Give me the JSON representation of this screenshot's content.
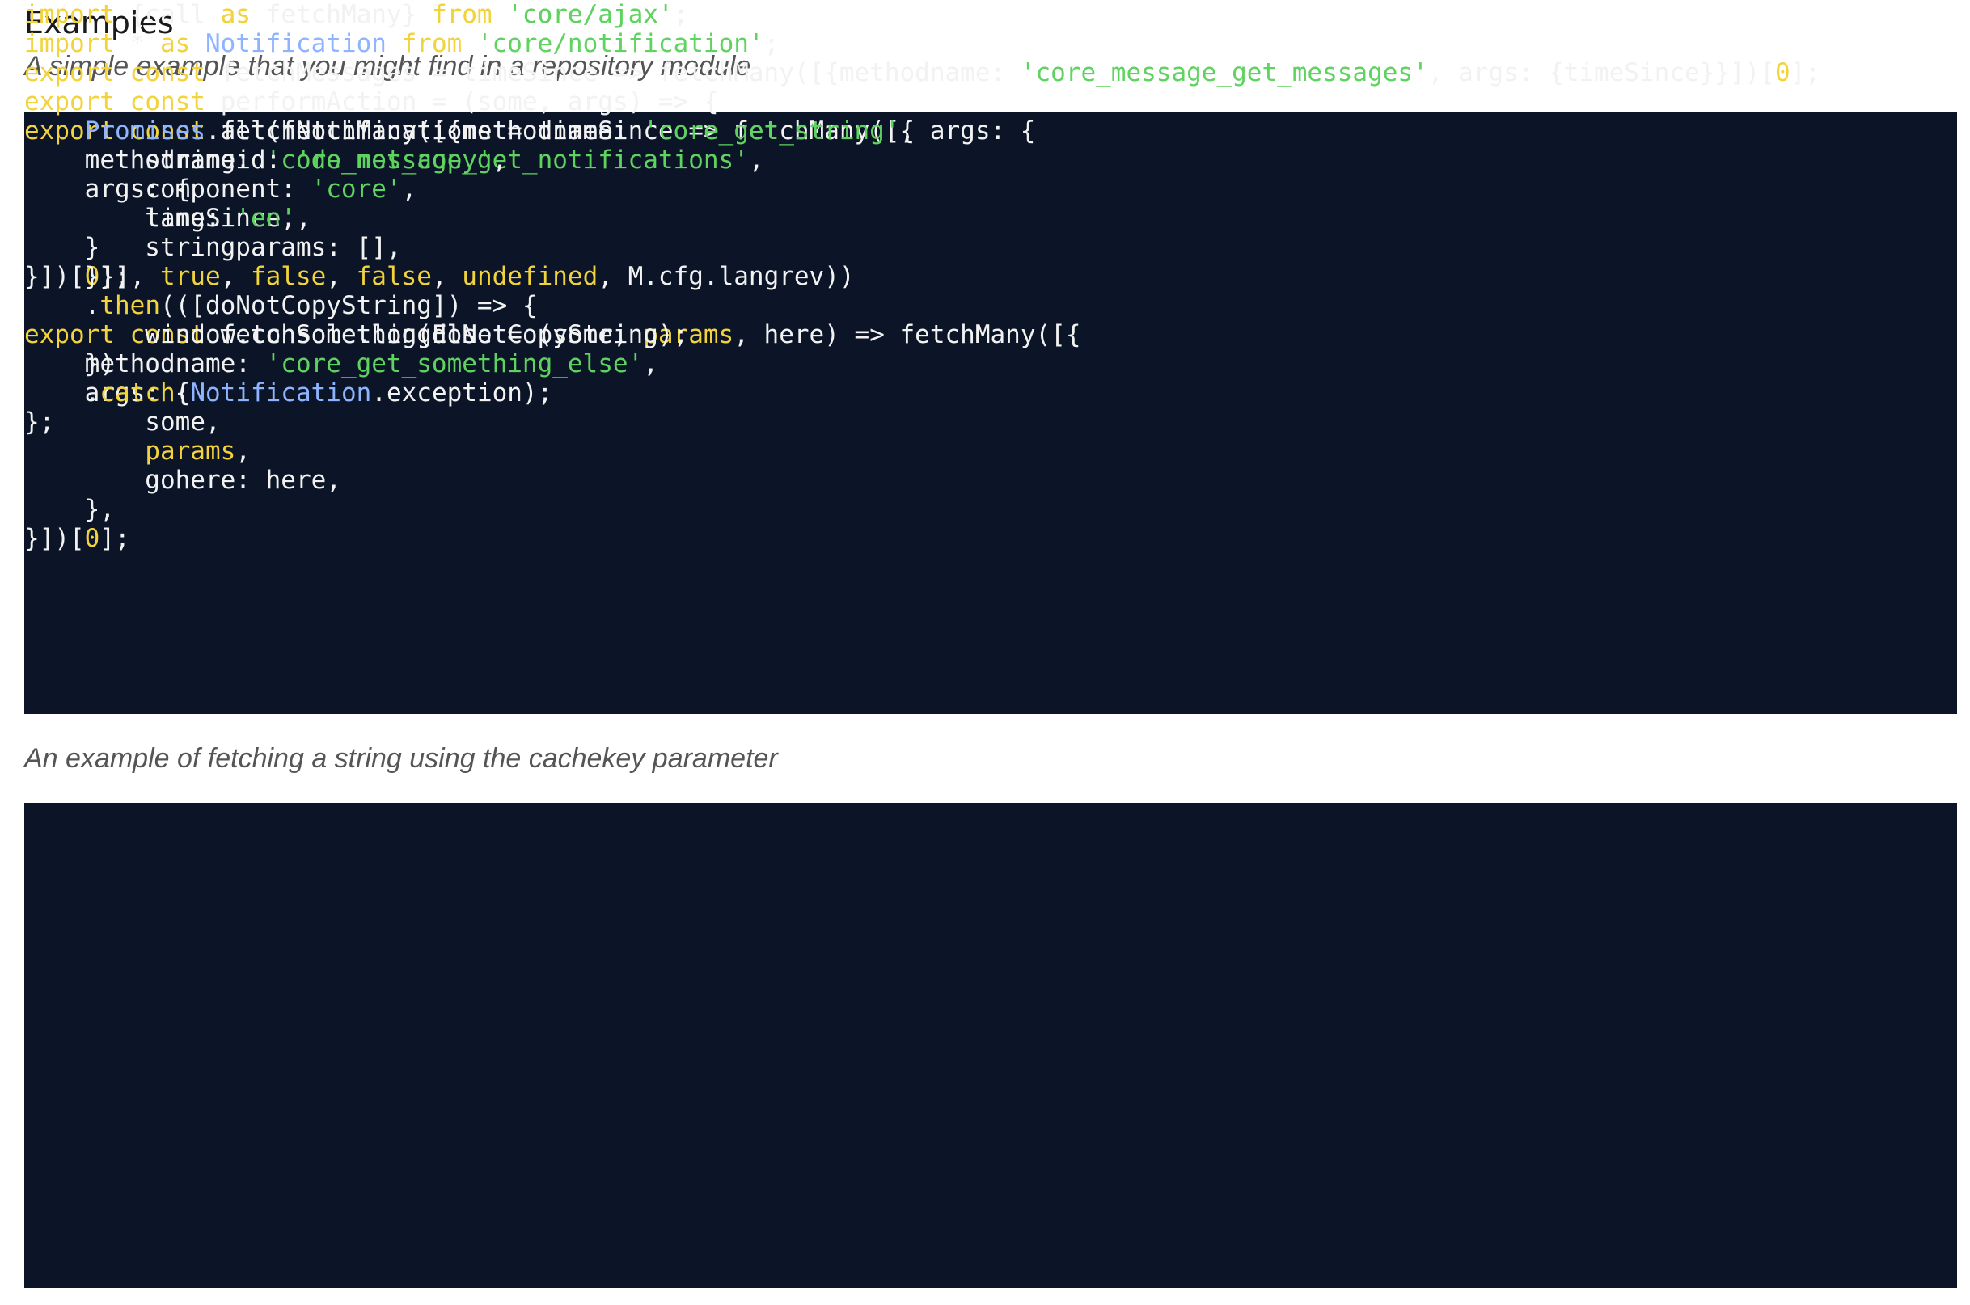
{
  "section": {
    "title": "Examples"
  },
  "example1": {
    "caption": "A simple example that you might find in a repository module",
    "lines": [
      [
        {
          "t": "kw",
          "v": "import"
        },
        {
          "t": "pl",
          "v": " {call "
        },
        {
          "t": "kw",
          "v": "as"
        },
        {
          "t": "pl",
          "v": " fetchMany} "
        },
        {
          "t": "kw",
          "v": "from"
        },
        {
          "t": "pl",
          "v": " "
        },
        {
          "t": "str",
          "v": "'core/ajax'"
        },
        {
          "t": "pl",
          "v": ";"
        }
      ],
      [],
      [
        {
          "t": "kw",
          "v": "export"
        },
        {
          "t": "pl",
          "v": " "
        },
        {
          "t": "kw",
          "v": "const"
        },
        {
          "t": "pl",
          "v": " fetchMessages = timeSince => fetchMany([{methodname: "
        },
        {
          "t": "str",
          "v": "'core_message_get_messages'"
        },
        {
          "t": "pl",
          "v": ", args: {timeSince}}])["
        },
        {
          "t": "num",
          "v": "0"
        },
        {
          "t": "pl",
          "v": "];"
        }
      ],
      [],
      [
        {
          "t": "kw",
          "v": "export"
        },
        {
          "t": "pl",
          "v": " "
        },
        {
          "t": "kw",
          "v": "const"
        },
        {
          "t": "pl",
          "v": " fetchNotifications = timeSince => fetchMany([{"
        }
      ],
      [
        {
          "t": "pl",
          "v": "    methodname: "
        },
        {
          "t": "str",
          "v": "'core_message_get_notifications'"
        },
        {
          "t": "pl",
          "v": ","
        }
      ],
      [
        {
          "t": "pl",
          "v": "    args: {"
        }
      ],
      [
        {
          "t": "pl",
          "v": "        timeSince,"
        }
      ],
      [
        {
          "t": "pl",
          "v": "    }"
        }
      ],
      [
        {
          "t": "pl",
          "v": "}])["
        },
        {
          "t": "num",
          "v": "0"
        },
        {
          "t": "pl",
          "v": "];"
        }
      ],
      [],
      [
        {
          "t": "kw",
          "v": "export"
        },
        {
          "t": "pl",
          "v": " "
        },
        {
          "t": "kw",
          "v": "const"
        },
        {
          "t": "pl",
          "v": " fetchSomethingElse = (some, "
        },
        {
          "t": "kw",
          "v": "params"
        },
        {
          "t": "pl",
          "v": ", here) => fetchMany([{"
        }
      ],
      [
        {
          "t": "pl",
          "v": "    methodname: "
        },
        {
          "t": "str",
          "v": "'core_get_something_else'"
        },
        {
          "t": "pl",
          "v": ","
        }
      ],
      [
        {
          "t": "pl",
          "v": "    args: {"
        }
      ],
      [
        {
          "t": "pl",
          "v": "        some,"
        }
      ],
      [
        {
          "t": "pl",
          "v": "        "
        },
        {
          "t": "kw",
          "v": "params"
        },
        {
          "t": "pl",
          "v": ","
        }
      ],
      [
        {
          "t": "pl",
          "v": "        gohere: here,"
        }
      ],
      [
        {
          "t": "pl",
          "v": "    },"
        }
      ],
      [
        {
          "t": "pl",
          "v": "}])["
        },
        {
          "t": "num",
          "v": "0"
        },
        {
          "t": "pl",
          "v": "];"
        }
      ]
    ]
  },
  "example2": {
    "caption": "An example of fetching a string using the cachekey parameter",
    "lines": [
      [
        {
          "t": "kw",
          "v": "import"
        },
        {
          "t": "pl",
          "v": " {call "
        },
        {
          "t": "kw",
          "v": "as"
        },
        {
          "t": "pl",
          "v": " fetchMany} "
        },
        {
          "t": "kw",
          "v": "from"
        },
        {
          "t": "pl",
          "v": " "
        },
        {
          "t": "str",
          "v": "'core/ajax'"
        },
        {
          "t": "pl",
          "v": ";"
        }
      ],
      [
        {
          "t": "kw",
          "v": "import"
        },
        {
          "t": "pl",
          "v": " * "
        },
        {
          "t": "kw",
          "v": "as"
        },
        {
          "t": "pl",
          "v": " "
        },
        {
          "t": "ty",
          "v": "Notification"
        },
        {
          "t": "pl",
          "v": " "
        },
        {
          "t": "kw",
          "v": "from"
        },
        {
          "t": "pl",
          "v": " "
        },
        {
          "t": "str",
          "v": "'core/notification'"
        },
        {
          "t": "pl",
          "v": ";"
        }
      ],
      [],
      [
        {
          "t": "kw",
          "v": "export"
        },
        {
          "t": "pl",
          "v": " "
        },
        {
          "t": "kw",
          "v": "const"
        },
        {
          "t": "pl",
          "v": " performAction = (some, args) => {"
        }
      ],
      [
        {
          "t": "pl",
          "v": "    "
        },
        {
          "t": "ty",
          "v": "Promises"
        },
        {
          "t": "pl",
          "v": ".all(fetchMany([{methodname: "
        },
        {
          "t": "str",
          "v": "'core_get_string'"
        },
        {
          "t": "pl",
          "v": ", args: {"
        }
      ],
      [
        {
          "t": "pl",
          "v": "        stringid: "
        },
        {
          "t": "str",
          "v": "'do_not_copy'"
        },
        {
          "t": "pl",
          "v": ","
        }
      ],
      [
        {
          "t": "pl",
          "v": "        component: "
        },
        {
          "t": "str",
          "v": "'core'"
        },
        {
          "t": "pl",
          "v": ","
        }
      ],
      [
        {
          "t": "pl",
          "v": "        lang: "
        },
        {
          "t": "str",
          "v": "'en'"
        },
        {
          "t": "pl",
          "v": ","
        }
      ],
      [
        {
          "t": "pl",
          "v": "        stringparams: [],"
        }
      ],
      [
        {
          "t": "pl",
          "v": "    }}], "
        },
        {
          "t": "kw",
          "v": "true"
        },
        {
          "t": "pl",
          "v": ", "
        },
        {
          "t": "kw",
          "v": "false"
        },
        {
          "t": "pl",
          "v": ", "
        },
        {
          "t": "kw",
          "v": "false"
        },
        {
          "t": "pl",
          "v": ", "
        },
        {
          "t": "kw",
          "v": "undefined"
        },
        {
          "t": "pl",
          "v": ", M.cfg.langrev))"
        }
      ],
      [
        {
          "t": "pl",
          "v": "    ."
        },
        {
          "t": "kw",
          "v": "then"
        },
        {
          "t": "pl",
          "v": "(([doNotCopyString]) => {"
        }
      ],
      [
        {
          "t": "pl",
          "v": "        window.console.log(doNotCopyString);"
        }
      ],
      [
        {
          "t": "pl",
          "v": "    })"
        }
      ],
      [
        {
          "t": "pl",
          "v": "    ."
        },
        {
          "t": "kw",
          "v": "catch"
        },
        {
          "t": "pl",
          "v": "("
        },
        {
          "t": "ty",
          "v": "Notification"
        },
        {
          "t": "pl",
          "v": ".exception);"
        }
      ],
      [
        {
          "t": "pl",
          "v": "};"
        }
      ]
    ]
  },
  "colors": {
    "code_background": "#0c1527",
    "keyword": "#f2d33c",
    "string": "#5fd35f",
    "type": "#8fb4ff",
    "plain": "#f2f2f2"
  }
}
